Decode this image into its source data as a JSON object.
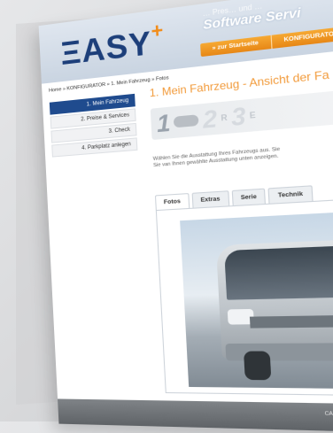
{
  "logo": {
    "text": "ΞASY",
    "plus": "+"
  },
  "header": {
    "tagline_small": "… Pres… und …",
    "tagline": "Software Servi",
    "nav": [
      "» zur Startseite",
      "KONFIGURATOR",
      "»"
    ]
  },
  "breadcrumb": "Home » KONFIGURATOR » 1. Mein Fahrzeug » Fotos",
  "sidebar": {
    "items": [
      "1. Mein Fahrzeug",
      "2. Preise & Services",
      "3. Check",
      "4. Parkplatz anlegen"
    ]
  },
  "main": {
    "title": "1. Mein Fahrzeug - Ansicht der Fa",
    "steps": {
      "n1": "1",
      "n2": "2",
      "n2_label": "R",
      "n3": "3",
      "n3_label": "E"
    },
    "description": [
      "Wählen Sie die Ausstattung Ihres Fahrzeugs aus. Sie",
      "Sie van Ihnen gewählte Ausstattung unten anzeigen."
    ]
  },
  "tabs": [
    "Fotos",
    "Extras",
    "Serie",
    "Technik"
  ],
  "footer": {
    "text": "CARMANO Software"
  }
}
